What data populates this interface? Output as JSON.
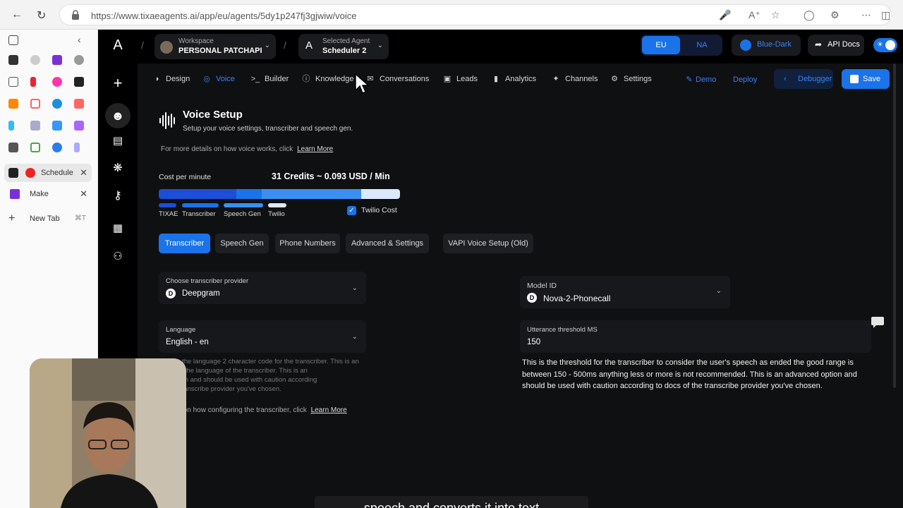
{
  "browser": {
    "url": "https://www.tixaeagents.ai/app/eu/agents/5dy1p247fj3gjwiw/voice"
  },
  "sidebar_tabs": [
    {
      "label": "Schedule",
      "active": true
    },
    {
      "label": "Make"
    },
    {
      "label": "New Tab",
      "shortcut": "⌘T"
    }
  ],
  "header": {
    "logo": "A",
    "workspace_label": "Workspace",
    "workspace_name": "PERSONAL PATCHAPI",
    "agent_label": "Selected Agent",
    "agent_name": "Scheduler 2",
    "agent_avatar": "A",
    "region_eu": "EU",
    "region_na": "NA",
    "theme": "Blue-Dark",
    "api_docs": "API Docs"
  },
  "tabs": [
    {
      "label": "Design",
      "icon": "design-icon"
    },
    {
      "label": "Voice",
      "icon": "voice-icon",
      "active": true
    },
    {
      "label": "Builder",
      "icon": "builder-icon"
    },
    {
      "label": "Knowledge",
      "icon": "knowledge-icon"
    },
    {
      "label": "Conversations",
      "icon": "conversations-icon"
    },
    {
      "label": "Leads",
      "icon": "leads-icon"
    },
    {
      "label": "Analytics",
      "icon": "analytics-icon"
    },
    {
      "label": "Channels",
      "icon": "channels-icon"
    },
    {
      "label": "Settings",
      "icon": "settings-icon"
    }
  ],
  "actions": {
    "demo": "Demo",
    "deploy": "Deploy",
    "debugger": "Debugger",
    "save": "Save"
  },
  "voice_setup": {
    "title": "Voice Setup",
    "subtitle": "Setup your voice settings, transcriber and speech gen.",
    "more_details": "For more details on how voice works, click",
    "learn_more": "Learn More",
    "cost_label": "Cost per minute",
    "cost_value": "31 Credits ~ 0.093 USD / Min",
    "cost_segments": [
      {
        "label": "TIXAE",
        "color": "#1d4ed8"
      },
      {
        "label": "Transcriber",
        "color": "#1a73e8"
      },
      {
        "label": "Speech Gen",
        "color": "#3b8ff0"
      },
      {
        "label": "Twilio",
        "color": "#dbe8ff"
      }
    ],
    "twilio_cost_label": "Twilio Cost",
    "twilio_cost_checked": true
  },
  "subtabs": [
    {
      "label": "Transcriber",
      "active": true
    },
    {
      "label": "Speech Gen"
    },
    {
      "label": "Phone Numbers"
    },
    {
      "label": "Advanced & Settings"
    },
    {
      "label": "VAPI Voice Setup (Old)"
    }
  ],
  "transcriber": {
    "provider_label": "Choose transcriber provider",
    "provider_value": "Deepgram",
    "language_label": "Language",
    "language_value": "English - en",
    "language_help": "This is the language 2 character code for the transcriber. This is an advanced option and should be used with caution according to docs of the transcribe provider you've chosen.",
    "language_help_visible": "This is the language 2 character code for the transcriber. This is an",
    "language_help_lines": [
      "This is the language 2 character code for the transcriber. This is an",
      "d to set the language of the transcriber. This is an",
      "ed option and should be used with caution according",
      "of the transcribe provider you've chosen."
    ],
    "config_help": "details on how configuring the transcriber, click",
    "config_learn_more": "Learn More",
    "model_label": "Model ID",
    "model_value": "Nova-2-Phonecall",
    "threshold_label": "Utterance threshold MS",
    "threshold_value": "150",
    "threshold_help": "This is the threshold for the transcriber to consider the user's speech as ended the good range is between 150 - 500ms anything less or more is not recommended. This is an advanced option and should be used with caution according to docs of the transcribe provider you've chosen."
  },
  "subtitle_caption": "speech and converts it into text"
}
